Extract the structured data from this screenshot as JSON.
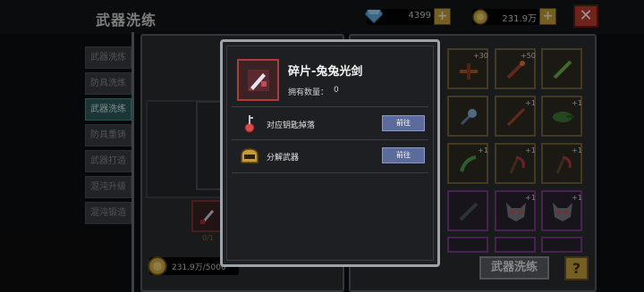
{
  "screen_title": "武器洗练",
  "currency": {
    "gems": "4399",
    "gold": "231.9万",
    "plus": "+",
    "close": "✕"
  },
  "tabs": [
    {
      "label": "武器洗炼",
      "active": false
    },
    {
      "label": "防具洗炼",
      "active": false
    },
    {
      "label": "武器洗练",
      "active": true
    },
    {
      "label": "防具重铸",
      "active": false
    },
    {
      "label": "武器打造",
      "active": false
    },
    {
      "label": "混沌升级",
      "active": false
    },
    {
      "label": "混沌锻造",
      "active": false
    }
  ],
  "left_panel": {
    "cost": "231.9万/5000",
    "slot_count": "0/1"
  },
  "grid": {
    "badges": [
      "+30",
      "+50",
      "+1",
      "+1",
      "+1",
      "+1",
      "+1",
      "+1",
      "+1"
    ]
  },
  "buttons": {
    "wash": "武器洗练",
    "help": "?"
  },
  "popup": {
    "item_name": "碎片-兔兔光剑",
    "own_label": "拥有数量：",
    "own_value": "0",
    "rows": [
      {
        "label": "对应钥匙掉落",
        "button": "前往"
      },
      {
        "label": "分解武器",
        "button": "前往"
      }
    ]
  },
  "colors": {
    "active_tab": "#2f5e60",
    "goto_button": "#5b6b9c",
    "close_button": "#c33b2e",
    "gold_button": "#c9a43a"
  }
}
